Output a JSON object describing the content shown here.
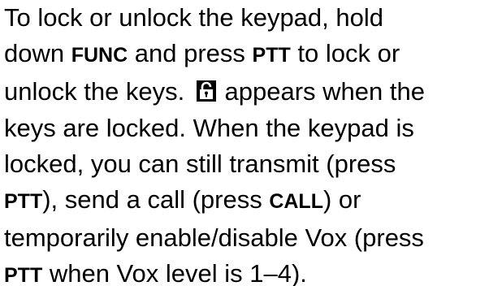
{
  "document": {
    "lines": [
      {
        "segments": [
          {
            "text": "To lock or unlock the keypad, hold"
          }
        ]
      },
      {
        "segments": [
          {
            "text": "down "
          },
          {
            "text": "FUNC",
            "key": true
          },
          {
            "text": " and press "
          },
          {
            "text": "PTT",
            "key": true
          },
          {
            "text": " to lock or"
          }
        ]
      },
      {
        "segments": [
          {
            "text": "unlock the keys. "
          },
          {
            "icon": "lock-icon"
          },
          {
            "text": " appears when the"
          }
        ]
      },
      {
        "segments": [
          {
            "text": "keys are locked. When the keypad is"
          }
        ]
      },
      {
        "segments": [
          {
            "text": "locked, you can still transmit (press"
          }
        ]
      },
      {
        "segments": [
          {
            "text": "PTT",
            "key": true
          },
          {
            "text": "), send a call (press "
          },
          {
            "text": "CALL",
            "key": true
          },
          {
            "text": ") or"
          }
        ]
      },
      {
        "segments": [
          {
            "text": "temporarily enable/disable Vox (press"
          }
        ]
      },
      {
        "segments": [
          {
            "text": "PTT",
            "key": true
          },
          {
            "text": " when Vox level is 1–4)."
          }
        ]
      }
    ]
  }
}
